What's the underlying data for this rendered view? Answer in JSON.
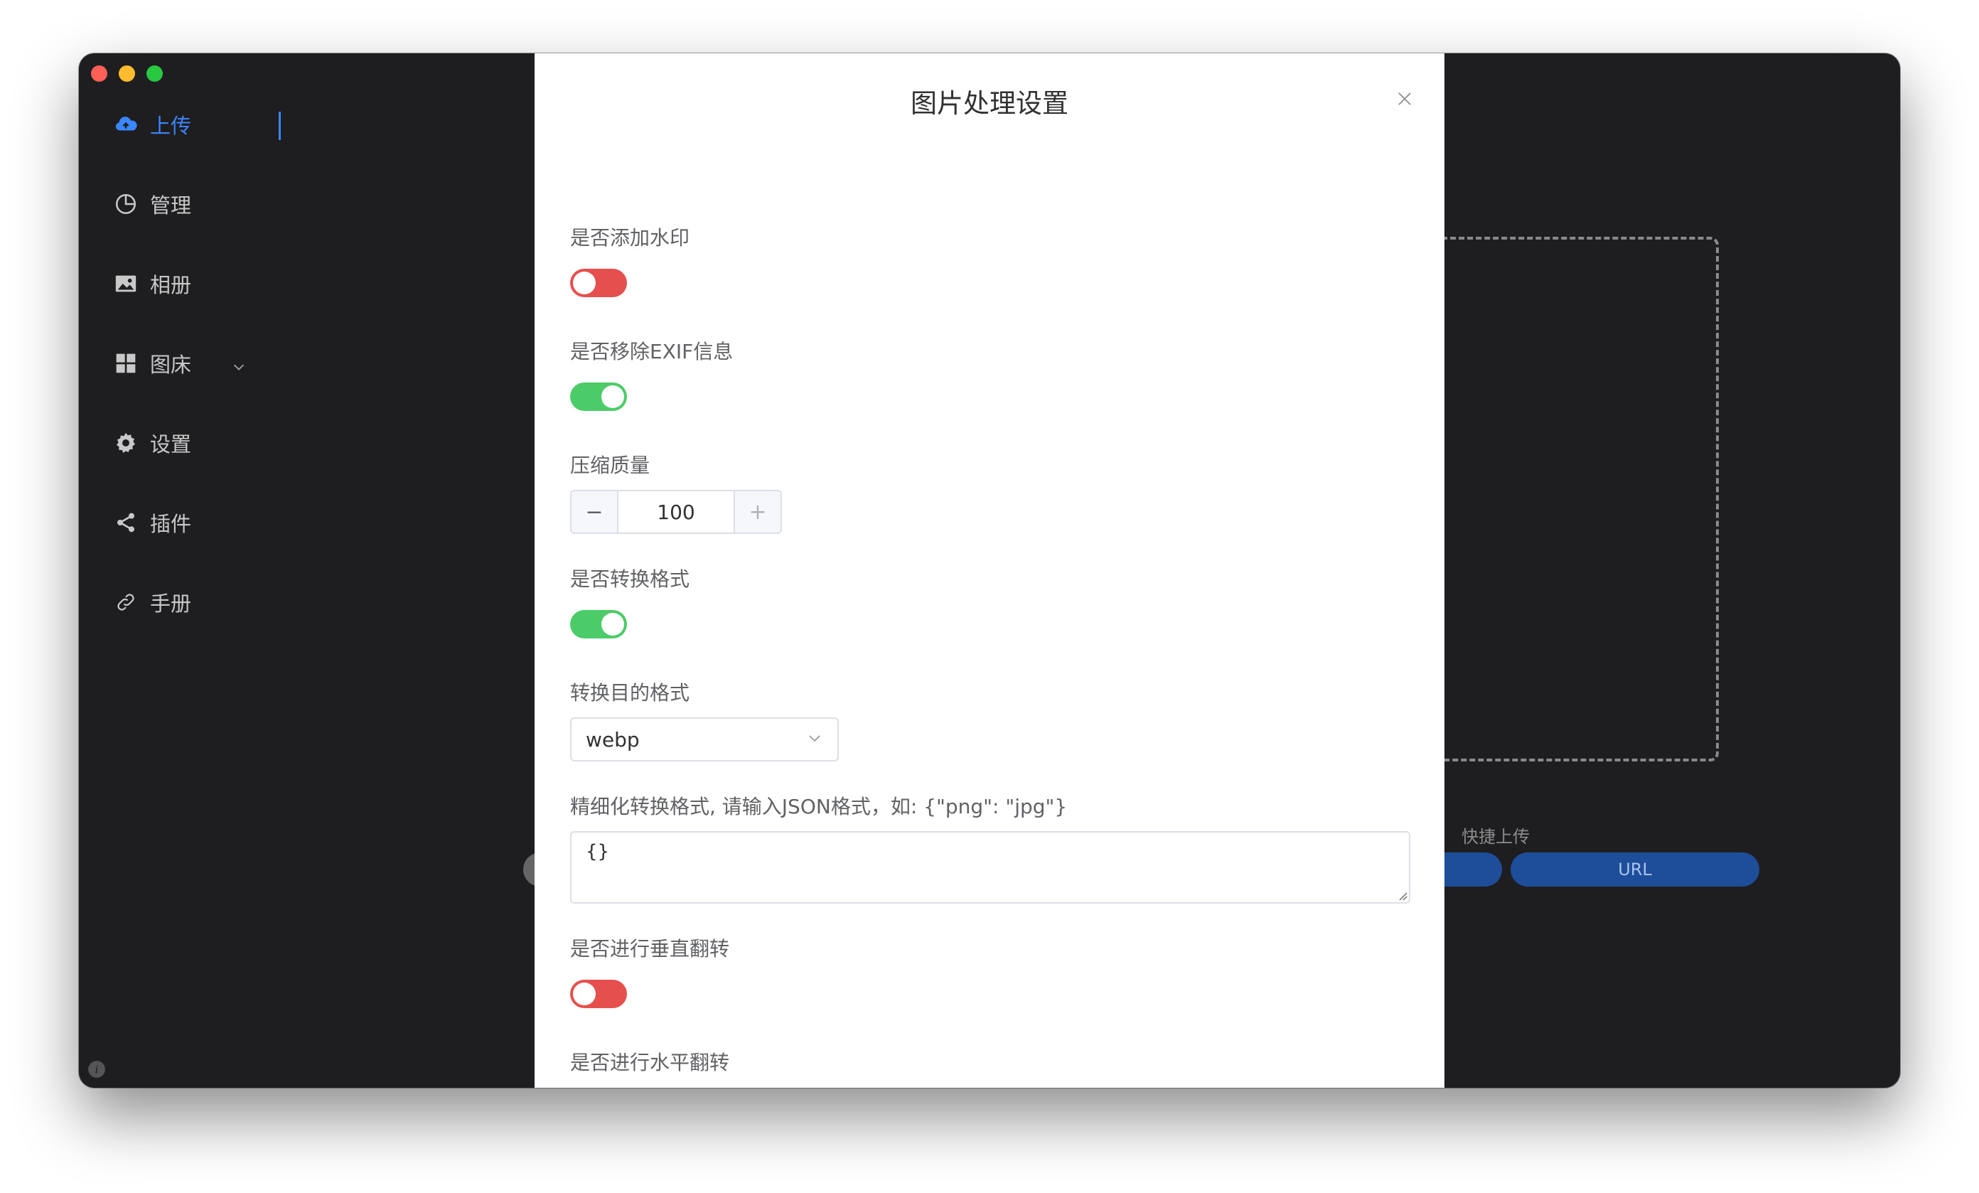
{
  "sidebar": {
    "items": [
      {
        "label": "上传",
        "icon": "cloud-upload-icon",
        "active": true
      },
      {
        "label": "管理",
        "icon": "pie-chart-icon"
      },
      {
        "label": "相册",
        "icon": "image-icon"
      },
      {
        "label": "图床",
        "icon": "grid-icon",
        "has_submenu": true
      },
      {
        "label": "设置",
        "icon": "gear-icon"
      },
      {
        "label": "插件",
        "icon": "share-icon"
      },
      {
        "label": "手册",
        "icon": "link-icon"
      }
    ]
  },
  "background": {
    "quick_upload_label": "快捷上传",
    "url_button": "URL"
  },
  "modal": {
    "title": "图片处理设置",
    "watermark": {
      "label": "是否添加水印",
      "enabled": false
    },
    "remove_exif": {
      "label": "是否移除EXIF信息",
      "enabled": true
    },
    "quality": {
      "label": "压缩质量",
      "value": "100",
      "minus": "−",
      "plus": "+"
    },
    "convert": {
      "label": "是否转换格式",
      "enabled": true
    },
    "target_format": {
      "label": "转换目的格式",
      "value": "webp"
    },
    "format_map": {
      "label": "精细化转换格式, 请输入JSON格式，如: {\"png\": \"jpg\"}",
      "value": "{}"
    },
    "flip_vertical": {
      "label": "是否进行垂直翻转",
      "enabled": false
    },
    "flip_horizontal": {
      "label": "是否进行水平翻转",
      "enabled": false
    }
  },
  "colors": {
    "accent": "#3a86ff",
    "switch_on": "#4ccc68",
    "switch_off": "#e5504f",
    "window_bg": "#1e1e20"
  }
}
